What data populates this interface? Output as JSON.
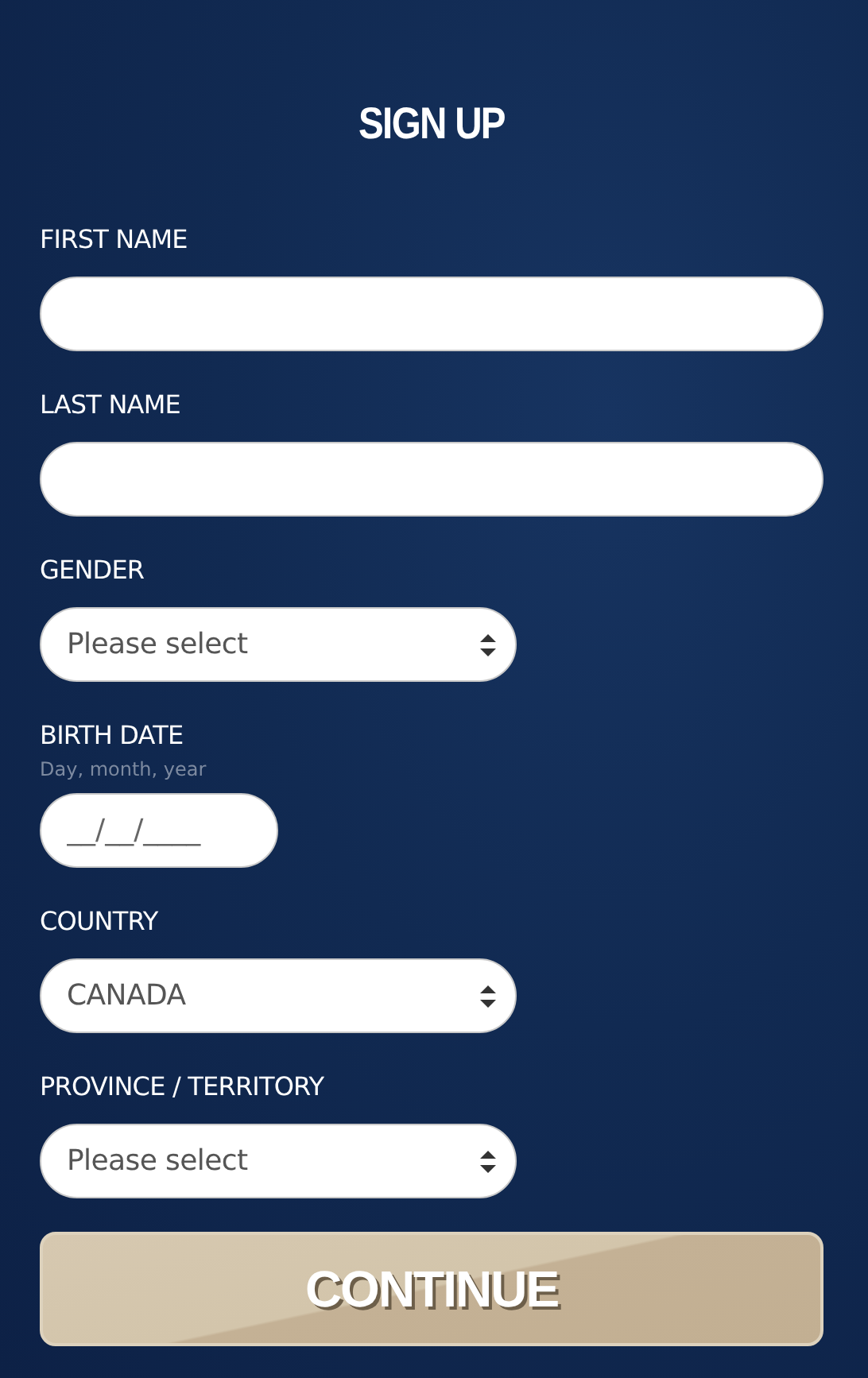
{
  "title": "SIGN UP",
  "fields": [
    {
      "kind": "text",
      "label": "FIRST NAME"
    },
    {
      "kind": "text",
      "label": "LAST NAME"
    },
    {
      "kind": "select",
      "label": "GENDER",
      "value": "Please select"
    },
    {
      "kind": "date",
      "label": "BIRTH DATE",
      "hint": "Day, month, year",
      "placeholder": "__/__/____"
    },
    {
      "kind": "select",
      "label": "COUNTRY",
      "value": "CANADA"
    },
    {
      "kind": "select",
      "label": "PROVINCE / TERRITORY",
      "value": "Please select"
    }
  ],
  "button": "CONTINUE"
}
